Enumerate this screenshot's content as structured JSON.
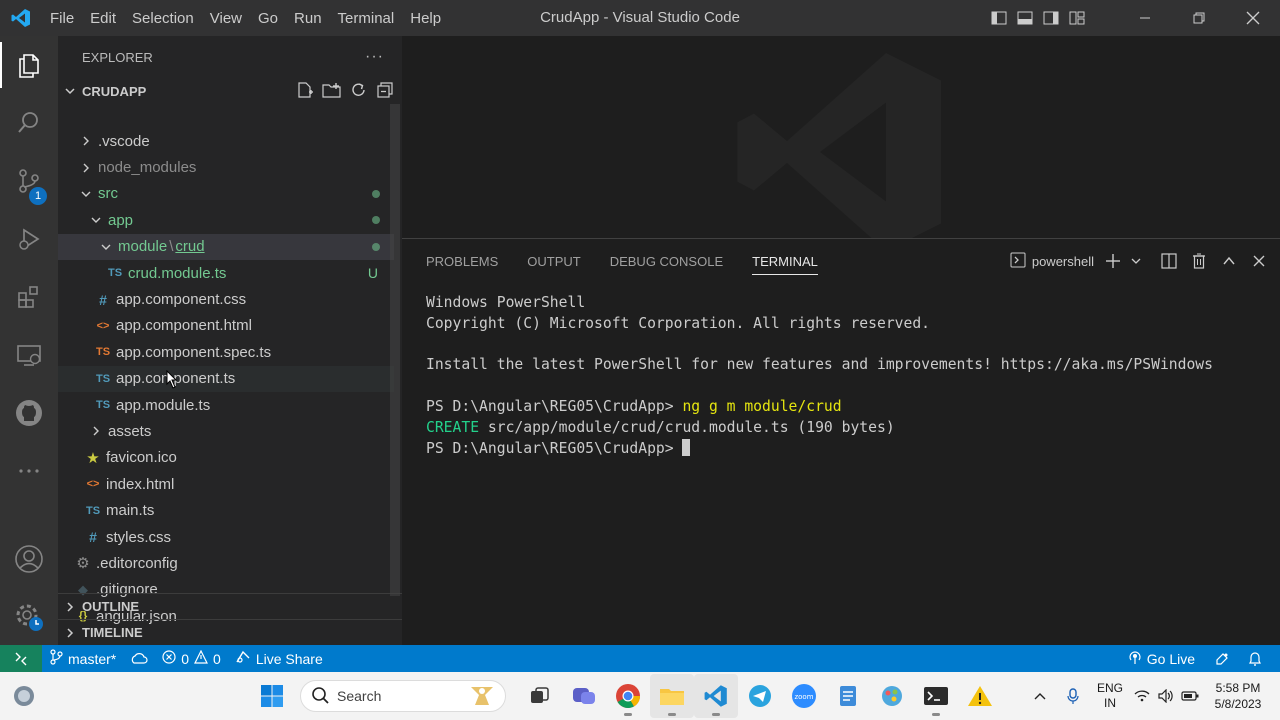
{
  "window": {
    "title": "CrudApp - Visual Studio Code",
    "menu": [
      "File",
      "Edit",
      "Selection",
      "View",
      "Go",
      "Run",
      "Terminal",
      "Help"
    ]
  },
  "activity_bar": {
    "items": [
      "files-icon",
      "search-icon",
      "source-control-icon",
      "run-debug-icon",
      "extensions-icon",
      "remote-explorer-icon",
      "github-icon",
      "more-icon"
    ],
    "source_control_badge": "1",
    "bottom": [
      "account-icon",
      "manage-gear-icon"
    ]
  },
  "explorer": {
    "header": "EXPLORER",
    "more": "···",
    "project": "CRUDAPP",
    "tree": [
      {
        "label": ".vscode",
        "icon": "chevron-right"
      },
      {
        "label": "node_modules",
        "icon": "chevron-right"
      },
      {
        "label": "src",
        "icon": "chevron-down"
      },
      {
        "label": "app",
        "icon": "chevron-down"
      },
      {
        "label_a": "module",
        "sep": "\\",
        "label_b": "crud",
        "icon": "chevron-down"
      },
      {
        "label": "crud.module.ts",
        "icon": "TS",
        "status": "U"
      },
      {
        "label": "app.component.css",
        "icon": "#"
      },
      {
        "label": "app.component.html",
        "icon": "<>"
      },
      {
        "label": "app.component.spec.ts",
        "icon": "TS"
      },
      {
        "label": "app.component.ts",
        "icon": "TS"
      },
      {
        "label": "app.module.ts",
        "icon": "TS"
      },
      {
        "label": "assets",
        "icon": "chevron-right"
      },
      {
        "label": "favicon.ico",
        "icon": "star"
      },
      {
        "label": "index.html",
        "icon": "<>"
      },
      {
        "label": "main.ts",
        "icon": "TS"
      },
      {
        "label": "styles.css",
        "icon": "#"
      },
      {
        "label": ".editorconfig",
        "icon": "gear"
      },
      {
        "label": ".gitignore",
        "icon": "diamond"
      },
      {
        "label": "angular.json",
        "icon": "{}"
      }
    ],
    "outline": "OUTLINE",
    "timeline": "TIMELINE"
  },
  "panel": {
    "tabs": [
      "PROBLEMS",
      "OUTPUT",
      "DEBUG CONSOLE",
      "TERMINAL"
    ],
    "active_tab": "TERMINAL",
    "shell": "powershell",
    "terminal": {
      "l1": "Windows PowerShell",
      "l2": "Copyright (C) Microsoft Corporation. All rights reserved.",
      "l3": "Install the latest PowerShell for new features and improvements! https://aka.ms/PSWindows",
      "prompt": "PS D:\\Angular\\REG05\\CrudApp>",
      "command": "ng g m module/crud",
      "create_kw": "CREATE",
      "create_rest": "src/app/module/crud/crud.module.ts (190 bytes)"
    }
  },
  "status_bar": {
    "branch": "master*",
    "errors": "0",
    "warnings": "0",
    "live_share": "Live Share",
    "go_live": "Go Live"
  },
  "taskbar": {
    "search_placeholder": "Search",
    "lang_1": "ENG",
    "lang_2": "IN",
    "time": "5:58 PM",
    "date": "5/8/2023"
  },
  "colors": {
    "accent": "#007acc",
    "remote": "#16825d",
    "git_untracked": "#73c991",
    "ts_icon": "#519aba",
    "spec_icon": "#e37933",
    "html_icon": "#e37933"
  }
}
